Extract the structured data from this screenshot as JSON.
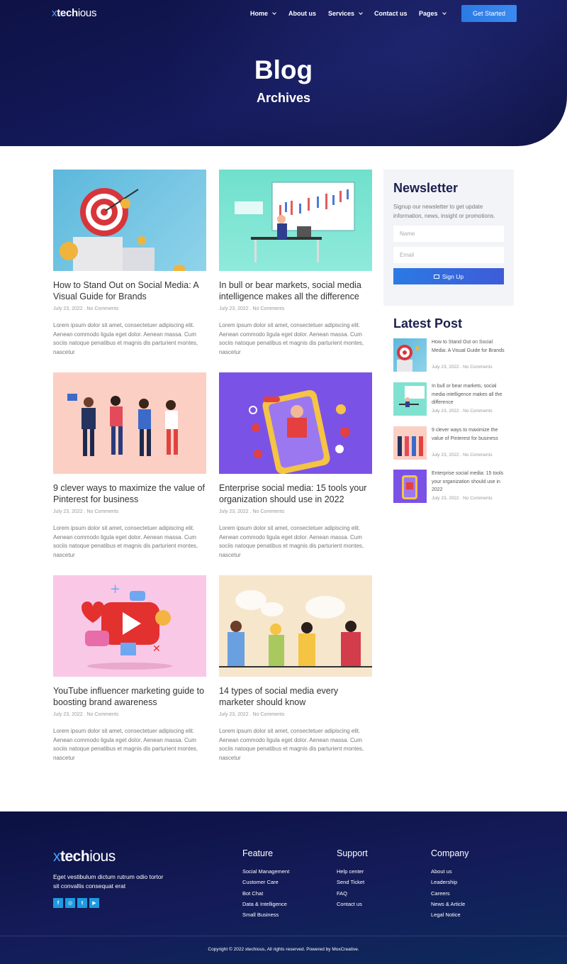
{
  "nav": {
    "logo_x": "x",
    "logo_bold": "tech",
    "logo_rest": "ious",
    "items": [
      "Home",
      "About us",
      "Services",
      "Contact us",
      "Pages"
    ],
    "cta": "Get Started"
  },
  "hero": {
    "title": "Blog",
    "subtitle": "Archives"
  },
  "posts": [
    {
      "title": "How to Stand Out on Social Media: A Visual Guide for Brands",
      "meta": "July 23, 2022 . No Comments",
      "excerpt": "Lorem ipsum dolor sit amet, consectetuer adipiscing elit. Aenean commodo ligula eget dolor. Aenean massa. Cum sociis natoque penatibus et magnis dis parturient montes, nascetur"
    },
    {
      "title": "In bull or bear markets, social media intelligence makes all the difference",
      "meta": "July 23, 2022 . No Comments",
      "excerpt": "Lorem ipsum dolor sit amet, consectetuer adipiscing elit. Aenean commodo ligula eget dolor. Aenean massa. Cum sociis natoque penatibus et magnis dis parturient montes, nascetur"
    },
    {
      "title": "9 clever ways to maximize the value of Pinterest for business",
      "meta": "July 23, 2022 . No Comments",
      "excerpt": "Lorem ipsum dolor sit amet, consectetuer adipiscing elit. Aenean commodo ligula eget dolor. Aenean massa. Cum sociis natoque penatibus et magnis dis parturient montes, nascetur"
    },
    {
      "title": "Enterprise social media: 15 tools your organization should use in 2022",
      "meta": "July 23, 2022 . No Comments",
      "excerpt": "Lorem ipsum dolor sit amet, consectetuer adipiscing elit. Aenean commodo ligula eget dolor. Aenean massa. Cum sociis natoque penatibus et magnis dis parturient montes, nascetur"
    },
    {
      "title": "YouTube influencer marketing guide to boosting brand awareness",
      "meta": "July 23, 2022 . No Comments",
      "excerpt": "Lorem ipsum dolor sit amet, consectetuer adipiscing elit. Aenean commodo ligula eget dolor. Aenean massa. Cum sociis natoque penatibus et magnis dis parturient montes, nascetur"
    },
    {
      "title": "14 types of social media every marketer should know",
      "meta": "July 23, 2022 . No Comments",
      "excerpt": "Lorem ipsum dolor sit amet, consectetuer adipiscing elit. Aenean commodo ligula eget dolor. Aenean massa. Cum sociis natoque penatibus et magnis dis parturient montes, nascetur"
    }
  ],
  "newsletter": {
    "title": "Newsletter",
    "description": "Signup our newsletter to get update information, news, insight or promotions.",
    "name_placeholder": "Name",
    "email_placeholder": "Email",
    "button": "Sign Up"
  },
  "latest": {
    "title": "Latest Post",
    "items": [
      {
        "title": "How to Stand Out on Social Media: A Visual Guide for Brands",
        "meta": "July 23, 2022 . No Comments"
      },
      {
        "title": "In bull or bear markets, social media intelligence makes all the difference",
        "meta": "July 23, 2022 . No Comments"
      },
      {
        "title": "9 clever ways to maximize the value of Pinterest for business",
        "meta": "July 23, 2022 . No Comments"
      },
      {
        "title": "Enterprise social media: 15 tools your organization should use in 2022",
        "meta": "July 23, 2022 . No Comments"
      }
    ]
  },
  "footer": {
    "logo_x": "x",
    "logo_bold": "tech",
    "logo_rest": "ious",
    "description": "Eget vestibulum dictum rutrum odio tortor sit convallis consequat erat",
    "social_icons": [
      "facebook-icon",
      "instagram-icon",
      "twitter-icon",
      "youtube-icon"
    ],
    "social_glyphs": [
      "f",
      "◎",
      "t",
      "▶"
    ],
    "columns": [
      {
        "title": "Feature",
        "links": [
          "Social Management",
          "Customer Care",
          "Bot Chat",
          "Data & Intelligence",
          "Small Business"
        ]
      },
      {
        "title": "Support",
        "links": [
          "Help center",
          "Send Ticket",
          "FAQ",
          "Contact us"
        ]
      },
      {
        "title": "Company",
        "links": [
          "About us",
          "Leadership",
          "Careers",
          "News & Article",
          "Legal Notice"
        ]
      }
    ],
    "copyright": "Copyright © 2022 xtechious, All rights reserved. Powered by MoxCreative."
  },
  "colors": {
    "hero_bg": "#121750",
    "accent": "#2b7ae4",
    "heading": "#1b1f4d",
    "social": "#1e9ae0"
  }
}
